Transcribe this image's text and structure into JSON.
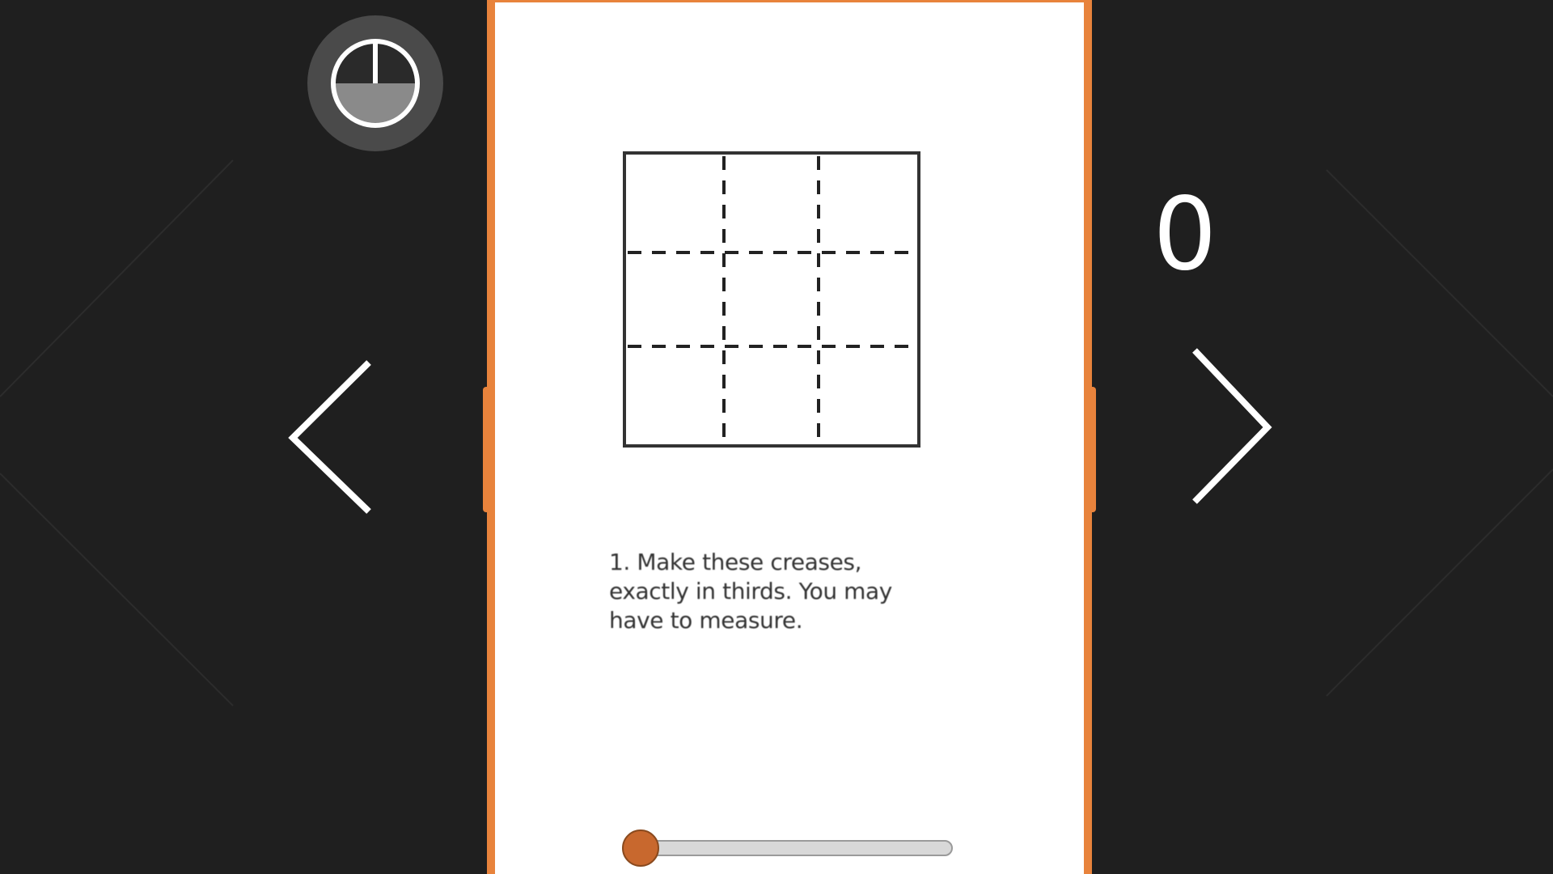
{
  "counter": {
    "value": "0"
  },
  "instruction": {
    "text": "1.  Make these creases,\nexactly in thirds. You may\nhave to measure."
  },
  "slider": {
    "fraction": 0.0
  },
  "timer": {
    "icon": "clock-icon",
    "fill_fraction": 0.5
  },
  "nav": {
    "prev_icon": "chevron-left-icon",
    "next_icon": "chevron-right-icon"
  },
  "diagram": {
    "icon": "crease-grid-diagram",
    "rows": 3,
    "columns": 3
  },
  "colors": {
    "background": "#1f1f1f",
    "accent": "#e8833c",
    "slider_thumb": "#c8682e",
    "card": "#ffffff",
    "text": "#333333"
  }
}
